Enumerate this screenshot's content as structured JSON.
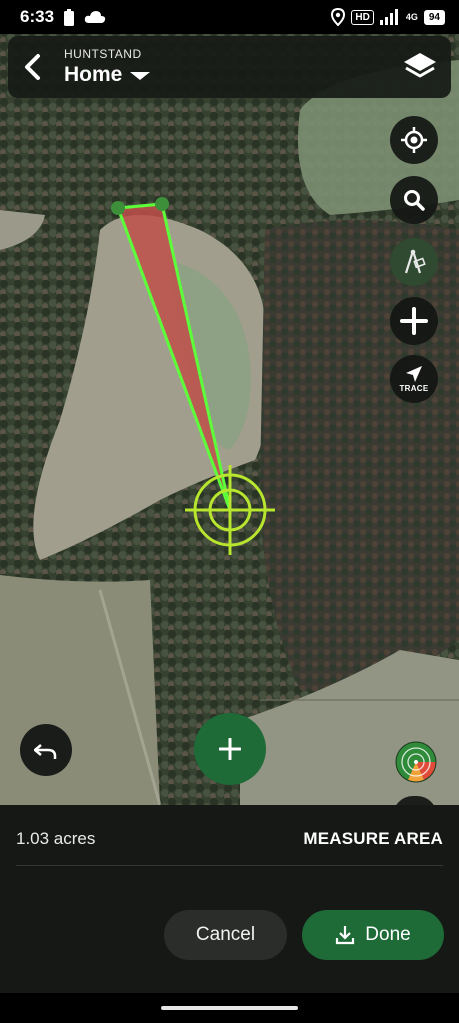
{
  "status_bar": {
    "time": "6:33",
    "hd_label": "HD",
    "network_label": "4G",
    "battery_level": "94"
  },
  "header": {
    "app_name": "HUNTSTAND",
    "map_name": "Home"
  },
  "map_controls": {
    "trace_label": "TRACE"
  },
  "measure_panel": {
    "area_value": "1.03 acres",
    "mode_label": "MEASURE AREA",
    "cancel_label": "Cancel",
    "done_label": "Done"
  },
  "colors": {
    "accent_green": "#1e6b37",
    "measure_line": "#5cff3a",
    "measure_fill": "#c0504a",
    "crosshair": "#b8e62e"
  },
  "icons": {
    "back": "chevron-left-icon",
    "dropdown": "caret-down-icon",
    "layers": "layers-icon",
    "locate": "crosshair-locate-icon",
    "search": "search-icon",
    "measure": "compass-ruler-icon",
    "add": "plus-icon",
    "trace": "trace-arrow-icon",
    "undo": "undo-icon",
    "wind": "wind-radar-icon",
    "download": "download-icon"
  }
}
